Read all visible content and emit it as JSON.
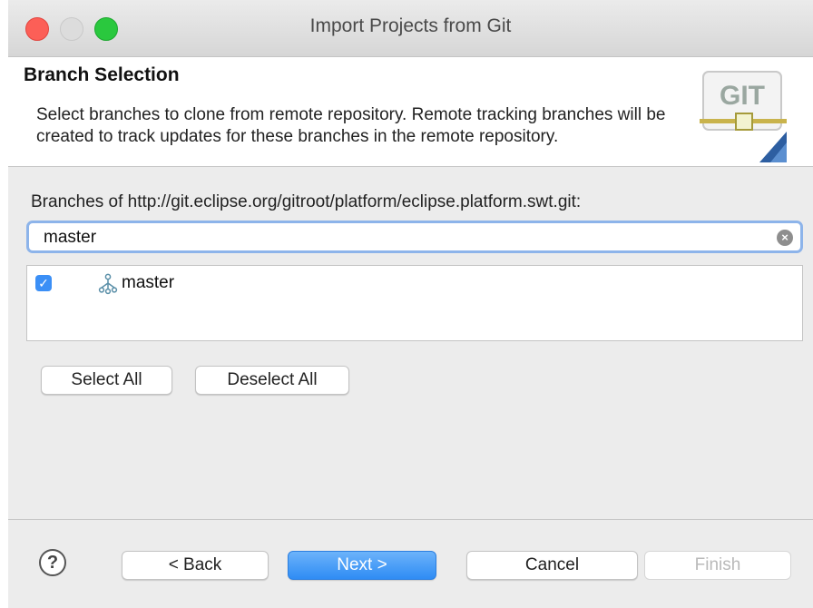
{
  "window": {
    "title": "Import Projects from Git"
  },
  "banner": {
    "title": "Branch Selection",
    "description": "Select branches to clone from remote repository. Remote tracking branches will be created to track updates for these branches in the remote repository.",
    "logo_text": "GIT",
    "logo_icon": "git-logo-icon"
  },
  "branches": {
    "label": "Branches of http://git.eclipse.org/gitroot/platform/eclipse.platform.swt.git:",
    "filter_value": "master",
    "items": [
      {
        "name": "master",
        "checked": true,
        "icon": "branch-icon"
      }
    ]
  },
  "selection_buttons": {
    "select_all": "Select All",
    "deselect_all": "Deselect All"
  },
  "footer": {
    "help_glyph": "?",
    "back": "< Back",
    "next": "Next >",
    "cancel": "Cancel",
    "finish": "Finish"
  },
  "colors": {
    "accent": "#3b8ff6",
    "close": "#fc5f57",
    "maximize": "#2ac83e",
    "disabled_text": "#b9b9b9"
  }
}
